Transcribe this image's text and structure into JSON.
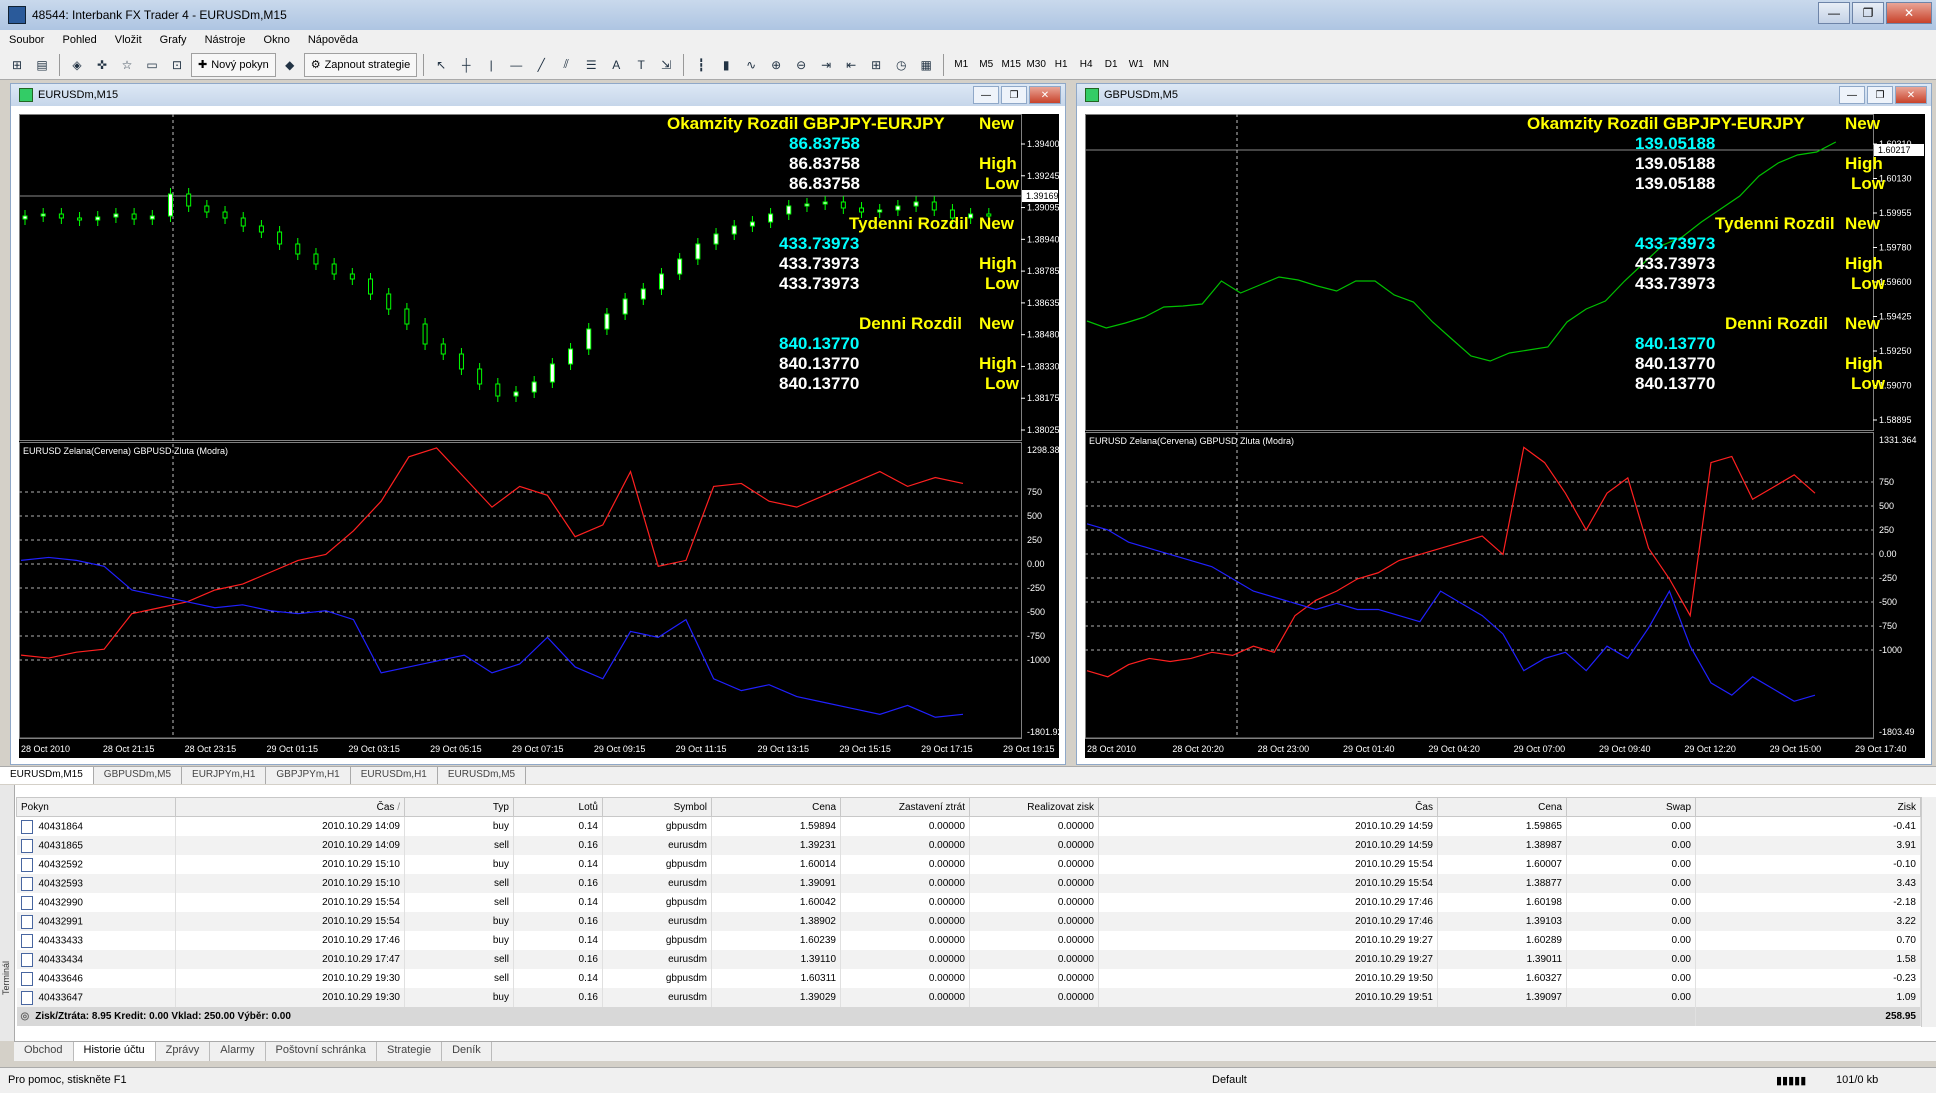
{
  "window": {
    "title": "48544: Interbank FX Trader 4 - EURUSDm,M15",
    "btn_min": "—",
    "btn_max": "❐",
    "btn_close": "✕"
  },
  "menu": [
    "Soubor",
    "Pohled",
    "Vložit",
    "Grafy",
    "Nástroje",
    "Okno",
    "Nápověda"
  ],
  "toolbar": {
    "new_order": "Nový pokyn",
    "strategies": "Zapnout strategie",
    "periods": [
      "M1",
      "M5",
      "M15",
      "M30",
      "H1",
      "H4",
      "D1",
      "W1",
      "MN"
    ]
  },
  "chart1": {
    "title": "EURUSDm,M15",
    "indicator_title": "EURUSD Zelana(Cervena) GBPUSD Zluta (Modra)",
    "overlay": {
      "h1": "Okamzity Rozdil GBPJPY-EURJPY",
      "new1": "New",
      "v1a": "86.83758",
      "v1b": "86.83758",
      "v1c": "86.83758",
      "high1": "High",
      "low1": "Low",
      "h2": "Tydenni Rozdil",
      "new2": "New",
      "v2a": "433.73973",
      "v2b": "433.73973",
      "v2c": "433.73973",
      "high2": "High",
      "low2": "Low",
      "h3": "Denni Rozdil",
      "new3": "New",
      "v3a": "840.13770",
      "v3b": "840.13770",
      "v3c": "840.13770",
      "high3": "High",
      "low3": "Low"
    },
    "price_axis": [
      "1.39400",
      "1.39245",
      "1.39095",
      "1.38940",
      "1.38785",
      "1.38635",
      "1.38480",
      "1.38330",
      "1.38175",
      "1.38025"
    ],
    "current_price": "1.39169",
    "ind_axis": [
      "1298.386",
      "750",
      "500",
      "250",
      "0.00",
      "-250",
      "-500",
      "-750",
      "-1000",
      "-1801.92"
    ],
    "time_axis": [
      "28 Oct 2010",
      "28 Oct 21:15",
      "28 Oct 23:15",
      "29 Oct 01:15",
      "29 Oct 03:15",
      "29 Oct 05:15",
      "29 Oct 07:15",
      "29 Oct 09:15",
      "29 Oct 11:15",
      "29 Oct 13:15",
      "29 Oct 15:15",
      "29 Oct 17:15",
      "29 Oct 19:15"
    ]
  },
  "chart2": {
    "title": "GBPUSDm,M5",
    "indicator_title": "EURUSD Zelana(Cervena) GBPUSD Zluta (Modra)",
    "overlay": {
      "h1": "Okamzity Rozdil GBPJPY-EURJPY",
      "new1": "New",
      "v1a": "139.05188",
      "v1b": "139.05188",
      "v1c": "139.05188",
      "high1": "High",
      "low1": "Low",
      "h2": "Tydenni Rozdil",
      "new2": "New",
      "v2a": "433.73973",
      "v2b": "433.73973",
      "v2c": "433.73973",
      "high2": "High",
      "low2": "Low",
      "h3": "Denni Rozdil",
      "new3": "New",
      "v3a": "840.13770",
      "v3b": "840.13770",
      "v3c": "840.13770",
      "high3": "High",
      "low3": "Low"
    },
    "price_axis": [
      "1.60310",
      "1.60130",
      "1.59955",
      "1.59780",
      "1.59600",
      "1.59425",
      "1.59250",
      "1.59070",
      "1.58895"
    ],
    "current_price": "1.60217",
    "ind_axis": [
      "1331.364",
      "750",
      "500",
      "250",
      "0.00",
      "-250",
      "-500",
      "-750",
      "-1000",
      "-1803.49"
    ],
    "time_axis": [
      "28 Oct 2010",
      "28 Oct 20:20",
      "28 Oct 23:00",
      "29 Oct 01:40",
      "29 Oct 04:20",
      "29 Oct 07:00",
      "29 Oct 09:40",
      "29 Oct 12:20",
      "29 Oct 15:00",
      "29 Oct 17:40"
    ]
  },
  "chart_tabs": [
    "EURUSDm,M15",
    "GBPUSDm,M5",
    "EURJPYm,H1",
    "GBPJPYm,H1",
    "EURUSDm,H1",
    "EURUSDm,M5"
  ],
  "terminal": {
    "side_label": "Terminál",
    "columns": [
      "Pokyn",
      "Čas",
      "Typ",
      "Lotů",
      "Symbol",
      "Cena",
      "Zastavení ztrát",
      "Realizovat zisk",
      "Čas",
      "Cena",
      "Swap",
      "Zisk"
    ],
    "sort_mark": "/",
    "rows": [
      [
        "40431864",
        "2010.10.29 14:09",
        "buy",
        "0.14",
        "gbpusdm",
        "1.59894",
        "0.00000",
        "0.00000",
        "2010.10.29 14:59",
        "1.59865",
        "0.00",
        "-0.41"
      ],
      [
        "40431865",
        "2010.10.29 14:09",
        "sell",
        "0.16",
        "eurusdm",
        "1.39231",
        "0.00000",
        "0.00000",
        "2010.10.29 14:59",
        "1.38987",
        "0.00",
        "3.91"
      ],
      [
        "40432592",
        "2010.10.29 15:10",
        "buy",
        "0.14",
        "gbpusdm",
        "1.60014",
        "0.00000",
        "0.00000",
        "2010.10.29 15:54",
        "1.60007",
        "0.00",
        "-0.10"
      ],
      [
        "40432593",
        "2010.10.29 15:10",
        "sell",
        "0.16",
        "eurusdm",
        "1.39091",
        "0.00000",
        "0.00000",
        "2010.10.29 15:54",
        "1.38877",
        "0.00",
        "3.43"
      ],
      [
        "40432990",
        "2010.10.29 15:54",
        "sell",
        "0.14",
        "gbpusdm",
        "1.60042",
        "0.00000",
        "0.00000",
        "2010.10.29 17:46",
        "1.60198",
        "0.00",
        "-2.18"
      ],
      [
        "40432991",
        "2010.10.29 15:54",
        "buy",
        "0.16",
        "eurusdm",
        "1.38902",
        "0.00000",
        "0.00000",
        "2010.10.29 17:46",
        "1.39103",
        "0.00",
        "3.22"
      ],
      [
        "40433433",
        "2010.10.29 17:46",
        "buy",
        "0.14",
        "gbpusdm",
        "1.60239",
        "0.00000",
        "0.00000",
        "2010.10.29 19:27",
        "1.60289",
        "0.00",
        "0.70"
      ],
      [
        "40433434",
        "2010.10.29 17:47",
        "sell",
        "0.16",
        "eurusdm",
        "1.39110",
        "0.00000",
        "0.00000",
        "2010.10.29 19:27",
        "1.39011",
        "0.00",
        "1.58"
      ],
      [
        "40433646",
        "2010.10.29 19:30",
        "sell",
        "0.14",
        "gbpusdm",
        "1.60311",
        "0.00000",
        "0.00000",
        "2010.10.29 19:50",
        "1.60327",
        "0.00",
        "-0.23"
      ],
      [
        "40433647",
        "2010.10.29 19:30",
        "buy",
        "0.16",
        "eurusdm",
        "1.39029",
        "0.00000",
        "0.00000",
        "2010.10.29 19:51",
        "1.39097",
        "0.00",
        "1.09"
      ]
    ],
    "summary": "Zisk/Ztráta: 8.95  Kredit: 0.00  Vklad: 250.00  Výběr: 0.00",
    "total": "258.95",
    "tabs": [
      "Obchod",
      "Historie účtu",
      "Zprávy",
      "Alarmy",
      "Poštovní schránka",
      "Strategie",
      "Deník"
    ]
  },
  "status": {
    "help": "Pro pomoc, stiskněte F1",
    "profile": "Default",
    "traffic": "101/0 kb"
  },
  "colors": {
    "chart_bg": "#000000",
    "candle_green": "#00ff00",
    "line_red": "#ff2020",
    "line_blue": "#2020ff",
    "text_yellow": "#ffff00",
    "text_cyan": "#00ffff"
  }
}
